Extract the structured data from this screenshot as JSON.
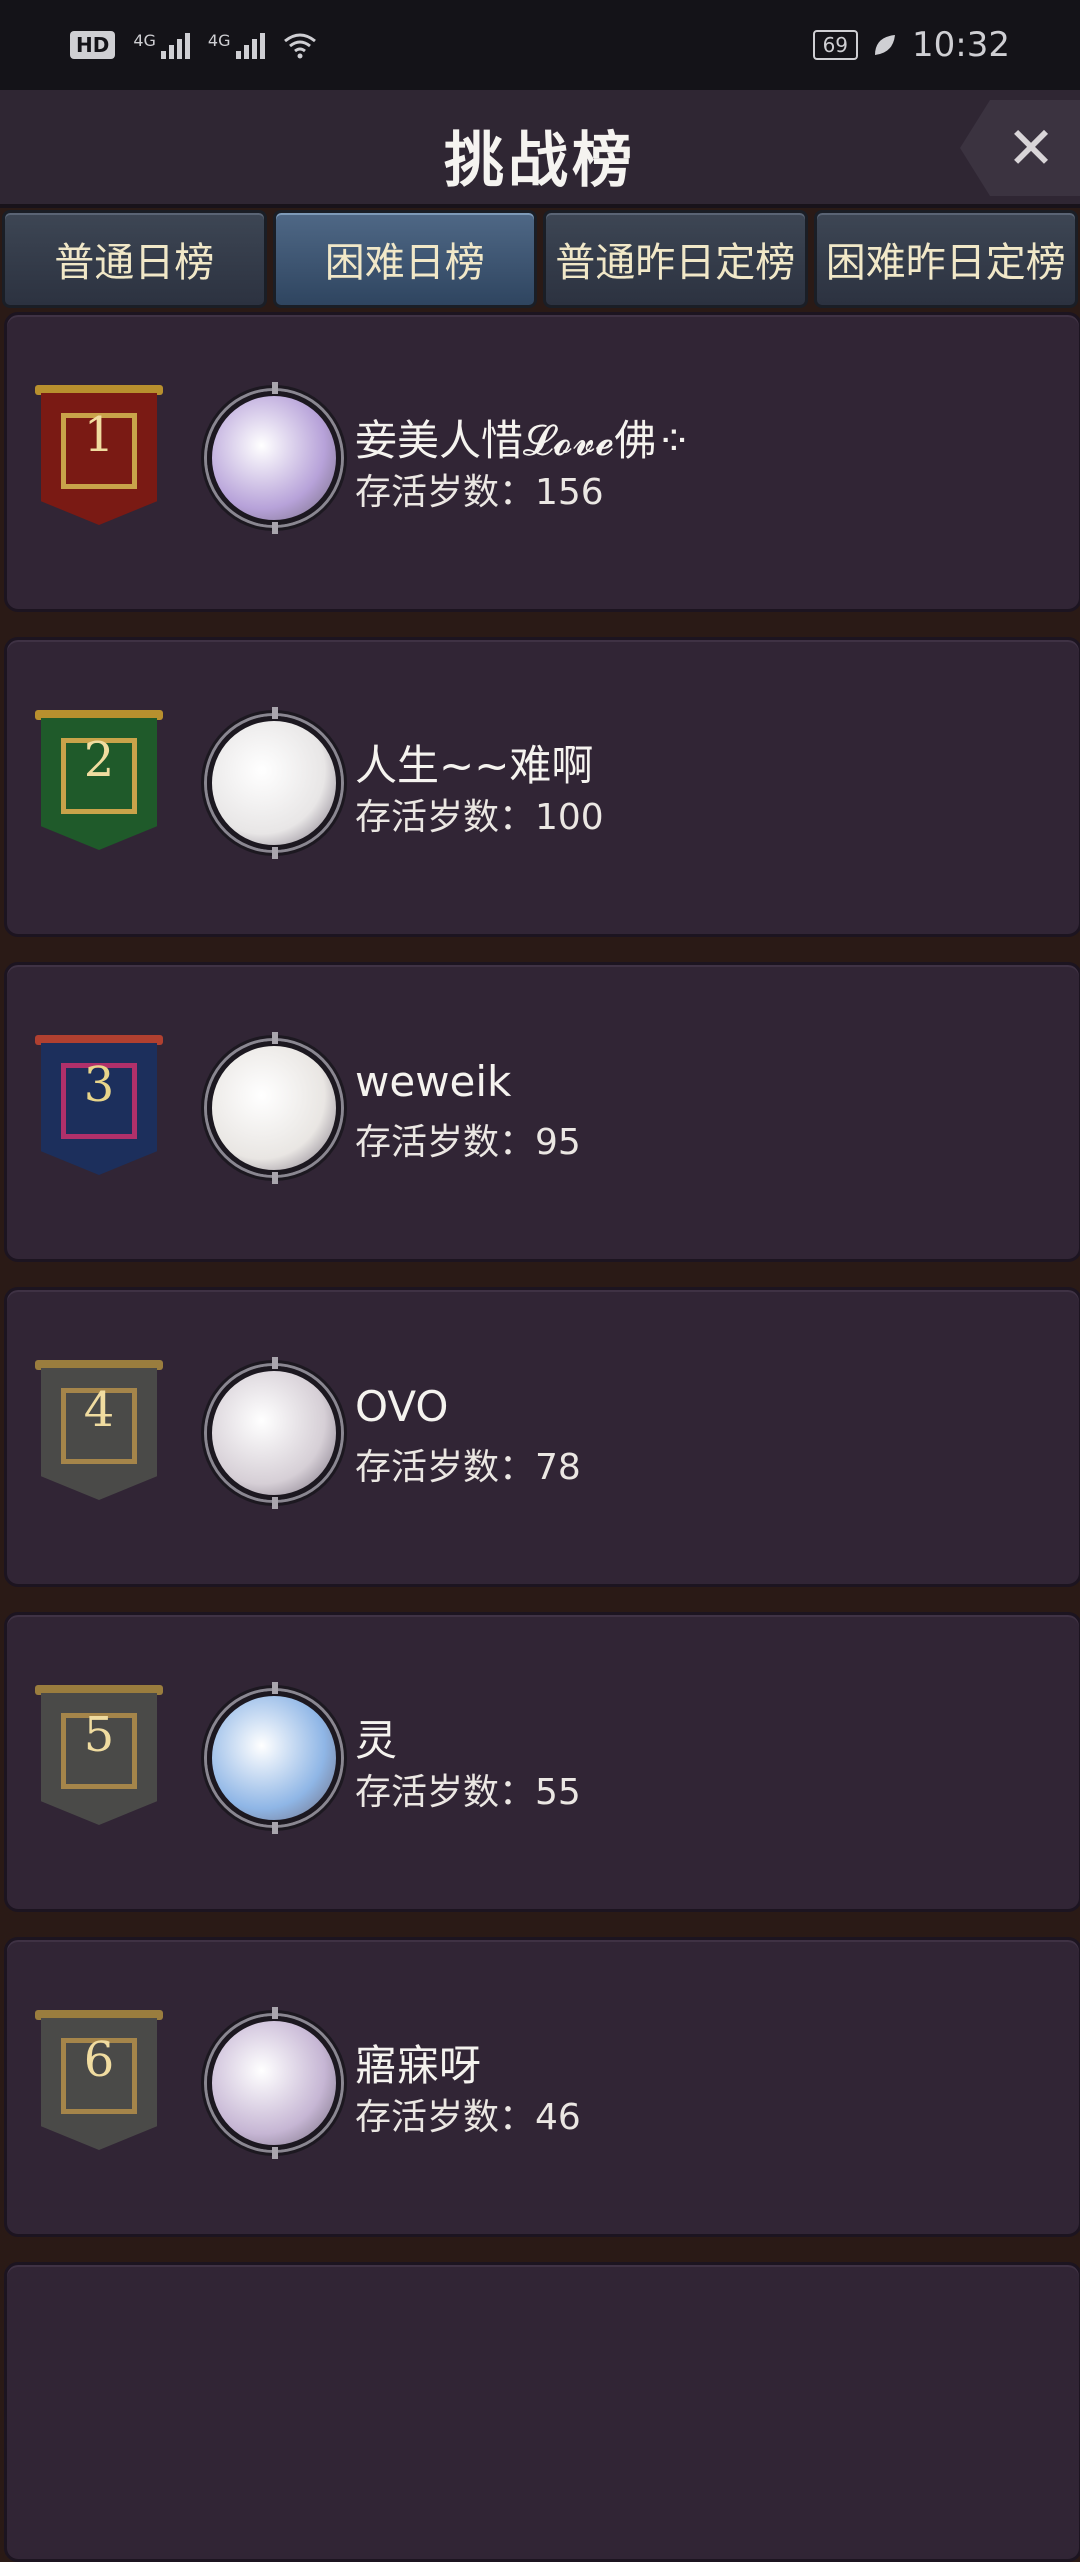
{
  "statusbar": {
    "hd": "HD",
    "sim1": "4G",
    "sim2": "4G",
    "battery": "69",
    "time": "10:32"
  },
  "header": {
    "title": "挑战榜",
    "close_symbol": "✕"
  },
  "tabs": [
    {
      "label": "普通日榜",
      "active": false
    },
    {
      "label": "困难日榜",
      "active": true
    },
    {
      "label": "普通昨日定榜",
      "active": false
    },
    {
      "label": "困难昨日定榜",
      "active": false
    }
  ],
  "rankings": [
    {
      "rank": "1",
      "name": "妾美人惜𝓛𝓸𝓿𝓮佛⁘",
      "age_label": "存活岁数：156",
      "banner_color": "#7a1a14",
      "frame_color": "#c9a34a",
      "rod_color": "#b8902e",
      "avatar_color": "#b7a2d9"
    },
    {
      "rank": "2",
      "name": "人生~~难啊",
      "age_label": "存活岁数：100",
      "banner_color": "#1f5a2a",
      "frame_color": "#c9a34a",
      "rod_color": "#b8902e",
      "avatar_color": "#e8e6e6"
    },
    {
      "rank": "3",
      "name": "weweik",
      "age_label": "存活岁数：95",
      "banner_color": "#1c2f5c",
      "frame_color": "#b0306a",
      "rod_color": "#b04030",
      "avatar_color": "#e9e6e3"
    },
    {
      "rank": "4",
      "name": "OVO",
      "age_label": "存活岁数：78",
      "banner_color": "#4a4a48",
      "frame_color": "#a5854a",
      "rod_color": "#9a7d3e",
      "avatar_color": "#d6cfd6"
    },
    {
      "rank": "5",
      "name": "灵",
      "age_label": "存活岁数：55",
      "banner_color": "#4a4a48",
      "frame_color": "#a5854a",
      "rod_color": "#9a7d3e",
      "avatar_color": "#8fb6e6"
    },
    {
      "rank": "6",
      "name": "寤寐呀",
      "age_label": "存活岁数：46",
      "banner_color": "#4a4a48",
      "frame_color": "#a5854a",
      "rod_color": "#9a7d3e",
      "avatar_color": "#c6b6d4"
    }
  ]
}
